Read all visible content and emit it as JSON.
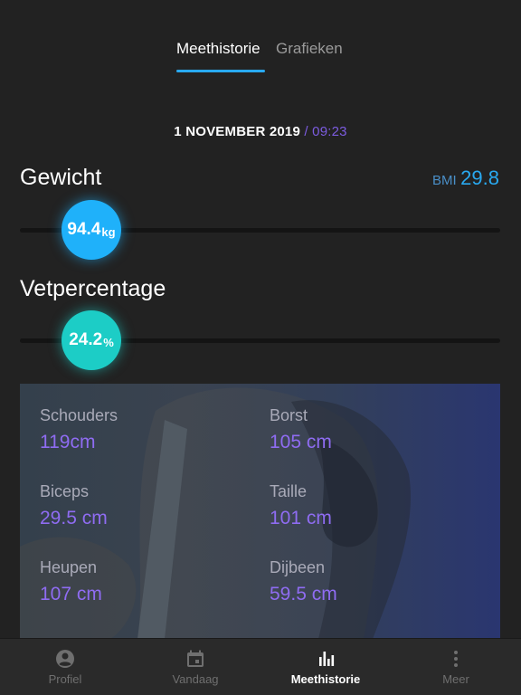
{
  "tabs": [
    {
      "label": "Meethistorie",
      "active": true
    },
    {
      "label": "Grafieken",
      "active": false
    }
  ],
  "measurement": {
    "date": "1 NOVEMBER 2019",
    "separator": "/",
    "time": "09:23"
  },
  "weight": {
    "label": "Gewicht",
    "value": "94.4",
    "unit": "kg",
    "bmi_label": "BMI",
    "bmi_value": "29.8"
  },
  "fat": {
    "label": "Vetpercentage",
    "value": "24.2",
    "unit": "%"
  },
  "body_measurements": [
    {
      "label": "Schouders",
      "value": "119cm"
    },
    {
      "label": "Borst",
      "value": "105 cm"
    },
    {
      "label": "Biceps",
      "value": "29.5 cm"
    },
    {
      "label": "Taille",
      "value": "101 cm"
    },
    {
      "label": "Heupen",
      "value": "107 cm"
    },
    {
      "label": "Dijbeen",
      "value": "59.5 cm"
    }
  ],
  "bottom_nav": [
    {
      "label": "Profiel",
      "icon": "profile-icon",
      "active": false
    },
    {
      "label": "Vandaag",
      "icon": "calendar-icon",
      "active": false
    },
    {
      "label": "Meethistorie",
      "icon": "bar-chart-icon",
      "active": true
    },
    {
      "label": "Meer",
      "icon": "more-vertical-icon",
      "active": false
    }
  ],
  "colors": {
    "accent_blue": "#1fb1fa",
    "accent_teal": "#1ccdc6",
    "accent_purple": "#8f6cf2",
    "background": "#222222"
  }
}
